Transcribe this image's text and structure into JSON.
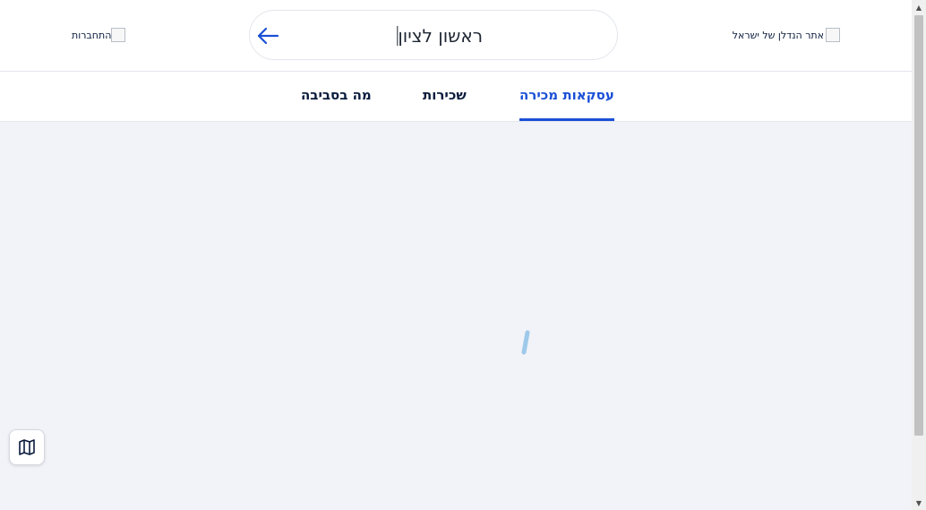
{
  "header": {
    "logo_alt": "אתר הנדלן של ישראל",
    "login_alt": "התחברות"
  },
  "search": {
    "value": "ראשון לציון",
    "arrow_icon": "arrow-left-icon"
  },
  "tabs": [
    {
      "label": "עסקאות מכירה",
      "active": true
    },
    {
      "label": "שכירות",
      "active": false
    },
    {
      "label": "מה בסביבה",
      "active": false
    }
  ],
  "map_button_icon": "map-icon",
  "colors": {
    "accent": "#1a4fd6",
    "text": "#0a1b3d",
    "content_bg": "#f1f3f8",
    "spinner": "#9ec9ea"
  }
}
